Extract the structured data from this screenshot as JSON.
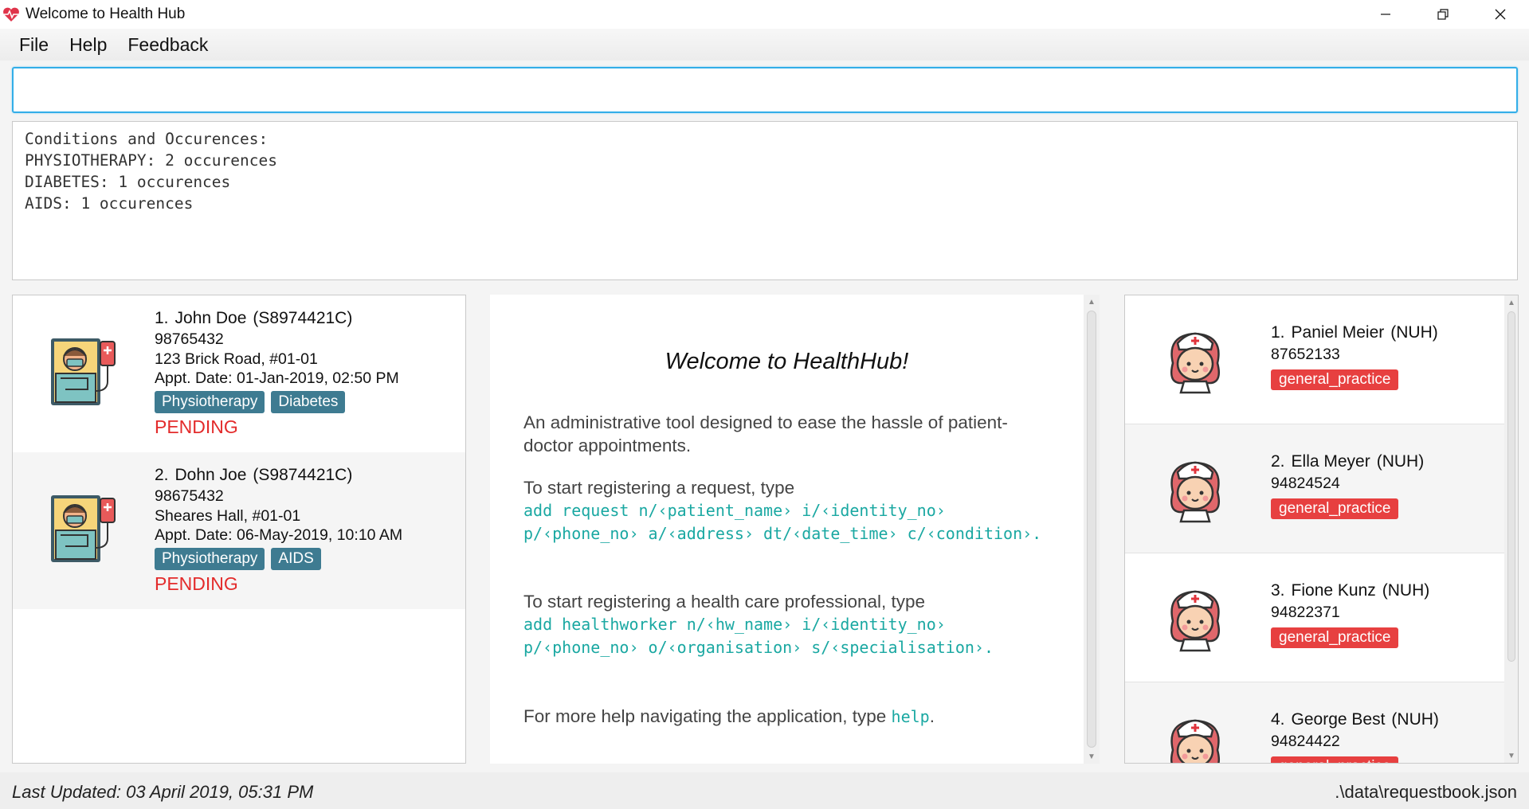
{
  "window": {
    "title": "Welcome to Health Hub",
    "icon": "heart-pulse-icon",
    "controls": [
      "minimize-icon",
      "restore-icon",
      "close-icon"
    ]
  },
  "menu": {
    "items": [
      "File",
      "Help",
      "Feedback"
    ]
  },
  "command_box": {
    "value": "",
    "placeholder": ""
  },
  "result_display": {
    "lines": [
      "Conditions and Occurences:",
      "PHYSIOTHERAPY: 2 occurences",
      "DIABETES: 1 occurences",
      "AIDS: 1 occurences"
    ]
  },
  "requests": [
    {
      "index": "1.",
      "name": "John Doe",
      "nric": "(S8974421C)",
      "phone": "98765432",
      "address": "123 Brick Road, #01-01",
      "appt": "Appt. Date: 01-Jan-2019, 02:50 PM",
      "conditions": [
        "Physiotherapy",
        "Diabetes"
      ],
      "status": "PENDING"
    },
    {
      "index": "2.",
      "name": "Dohn Joe",
      "nric": "(S9874421C)",
      "phone": "98675432",
      "address": "Sheares Hall, #01-01",
      "appt": "Appt. Date: 06-May-2019, 10:10 AM",
      "conditions": [
        "Physiotherapy",
        "AIDS"
      ],
      "status": "PENDING"
    }
  ],
  "help": {
    "title": "Welcome to HealthHub!",
    "intro": "An administrative tool designed to ease the hassle of patient-doctor appointments.",
    "request_prompt": "To start registering a request, type",
    "request_cmd_1": "add request n/‹patient_name› i/‹identity_no›",
    "request_cmd_2": "p/‹phone_no› a/‹address› dt/‹date_time› c/‹condition›.",
    "hw_prompt": "To start registering a health care professional, type",
    "hw_cmd_1": "add healthworker n/‹hw_name› i/‹identity_no›",
    "hw_cmd_2": "p/‹phone_no› o/‹organisation› s/‹specialisation›.",
    "more_prefix": "For more help navigating the application, type ",
    "more_cmd": "help",
    "more_suffix": "."
  },
  "healthworkers": [
    {
      "index": "1.",
      "name": "Paniel Meier",
      "org": "(NUH)",
      "phone": "87652133",
      "specialisation": "general_practice"
    },
    {
      "index": "2.",
      "name": "Ella Meyer",
      "org": "(NUH)",
      "phone": "94824524",
      "specialisation": "general_practice"
    },
    {
      "index": "3.",
      "name": "Fione Kunz",
      "org": "(NUH)",
      "phone": "94822371",
      "specialisation": "general_practice"
    },
    {
      "index": "4.",
      "name": "George Best",
      "org": "(NUH)",
      "phone": "94824422",
      "specialisation": "general_practice"
    }
  ],
  "statusbar": {
    "last_updated": "Last Updated: 03 April 2019, 05:31 PM",
    "file_path": ".\\data\\requestbook.json"
  },
  "colors": {
    "accent": "#33aee8",
    "condition_tag": "#3e7b91",
    "specialisation_tag": "#e74040",
    "pending": "#e32b2b",
    "code": "#1aa8a2"
  }
}
